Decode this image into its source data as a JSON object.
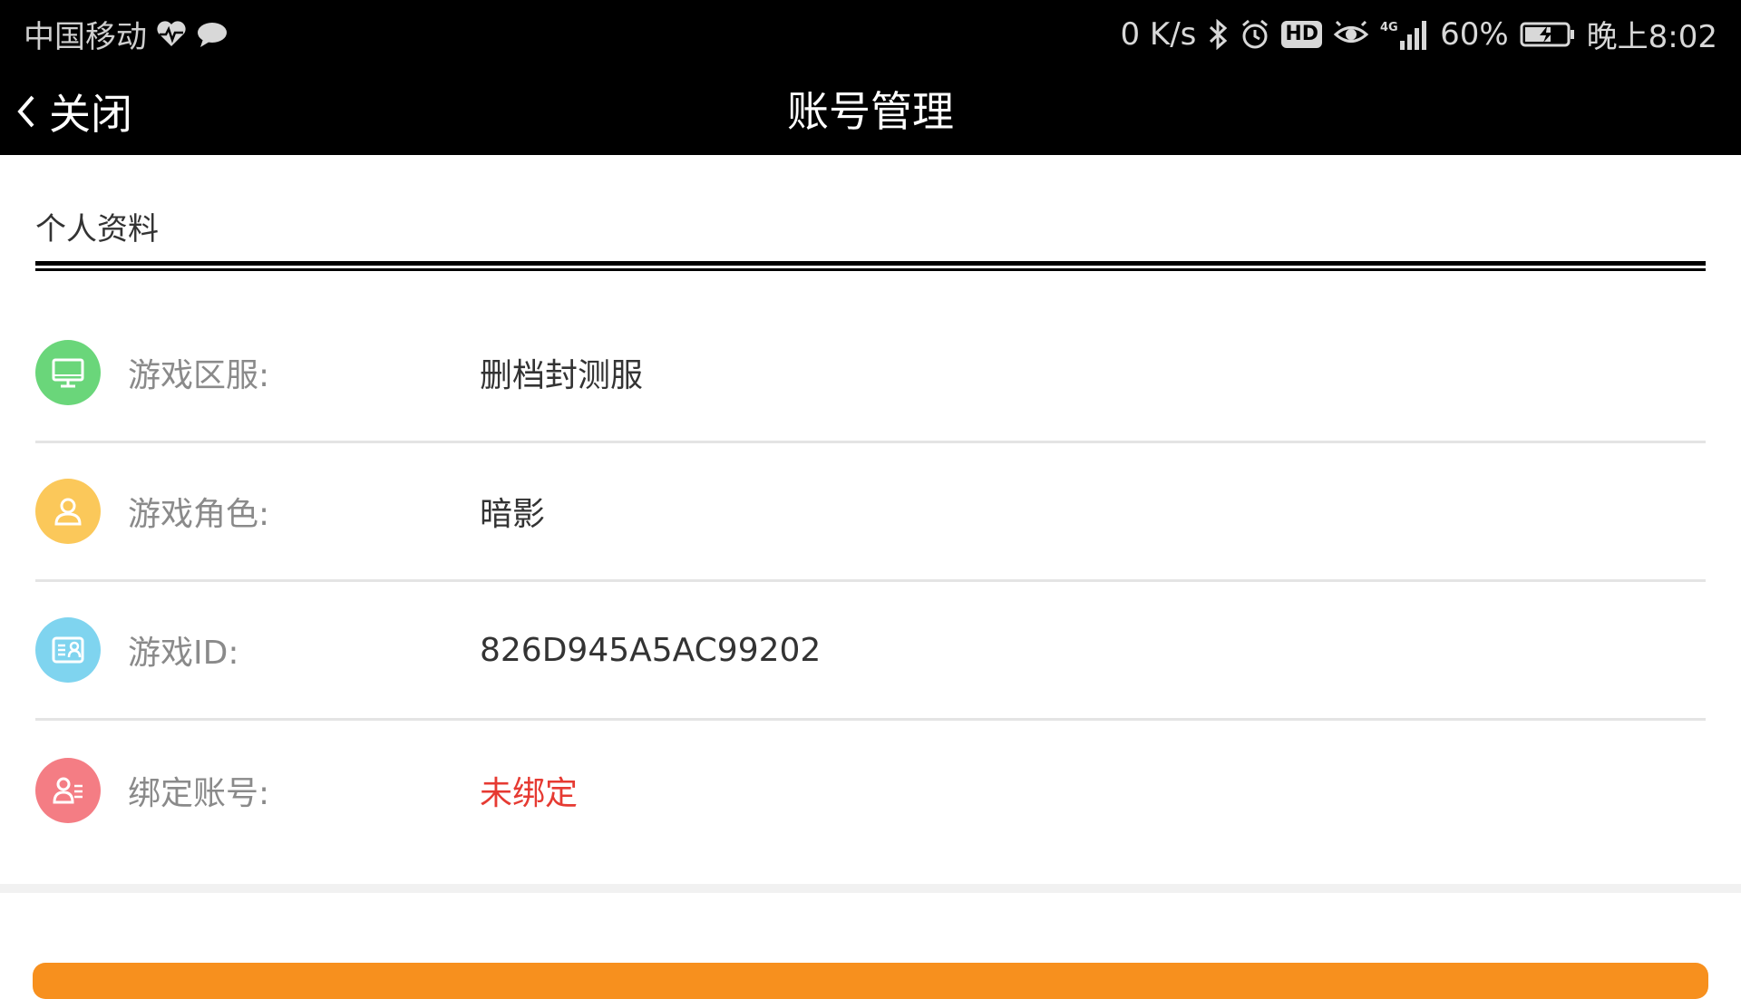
{
  "status_bar": {
    "carrier": "中国移动",
    "net_speed": "0 K/s",
    "hd_badge": "HD",
    "network_type": "4G",
    "battery_percent": "60%",
    "time": "晚上8:02",
    "icons": [
      "heart-rate-icon",
      "chat-bubble-icon",
      "bluetooth-icon",
      "alarm-icon",
      "eye-icon",
      "signal-icon",
      "battery-charging-icon"
    ]
  },
  "title_bar": {
    "back_label": "关闭",
    "title": "账号管理"
  },
  "section": {
    "header": "个人资料"
  },
  "rows": [
    {
      "icon": "monitor-icon",
      "icon_color": "#6ad67a",
      "label": "游戏区服:",
      "value": "删档封测服",
      "value_color": "#333333"
    },
    {
      "icon": "user-icon",
      "icon_color": "#fbc85a",
      "label": "游戏角色:",
      "value": "暗影",
      "value_color": "#333333"
    },
    {
      "icon": "id-card-icon",
      "icon_color": "#7fd4ef",
      "label": "游戏ID:",
      "value": "826D945A5AC99202",
      "value_color": "#333333"
    },
    {
      "icon": "bind-account-icon",
      "icon_color": "#f47d84",
      "label": "绑定账号:",
      "value": "未绑定",
      "value_color": "#e63a32"
    }
  ],
  "colors": {
    "header_bg": "#000000",
    "accent_button": "#f7901e"
  }
}
